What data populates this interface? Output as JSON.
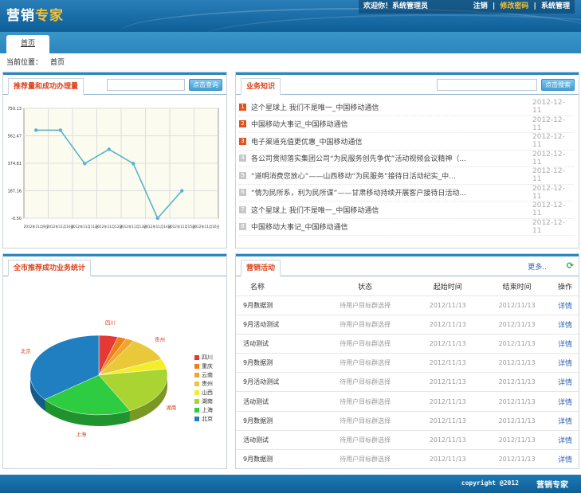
{
  "header": {
    "logo_a": "营销",
    "logo_b": "专家",
    "welcome": "欢迎你！系统管理员",
    "logout": "注销",
    "sep": "|",
    "change_password": "修改密码",
    "system_admin": "系统管理"
  },
  "nav": {
    "home_tab": "首页"
  },
  "breadcrumb": {
    "label": "当前位置：",
    "value": "首页"
  },
  "recommend": {
    "title": "推荐量和成功办理量",
    "search_button": "点击查询",
    "chart_data": {
      "type": "line",
      "categories": [
        "2012年11月9日",
        "2012年11月10日",
        "2012年11月11日",
        "2012年11月12日",
        "2012年11月13日",
        "2012年11月14日",
        "2012年11月15日",
        "2012年11月16日"
      ],
      "values": [
        601,
        601,
        373,
        470,
        373,
        -0.5,
        187
      ],
      "ytick_labels": [
        "-0.50",
        "187.16",
        "374.81",
        "562.47",
        "750.13"
      ],
      "ylim": [
        -0.5,
        750.13
      ],
      "grid": true,
      "colors": {
        "line": "#5ab2cc"
      }
    }
  },
  "knowledge": {
    "title": "业务知识",
    "search_button": "点击搜索",
    "items": [
      {
        "num": "1",
        "title": "这个星球上 我们不是唯一_中国移动通信",
        "date": "2012-12-11"
      },
      {
        "num": "2",
        "title": "中国移动大事记_中国移动通信",
        "date": "2012-12-11"
      },
      {
        "num": "3",
        "title": "电子渠道充值更优惠_中国移动通信",
        "date": "2012-12-11"
      },
      {
        "num": "4",
        "title": "各公司贯彻落实集团公司“为民服务创先争优”活动视频会议精神（...",
        "date": "2012-12-11"
      },
      {
        "num": "5",
        "title": "“道明消费您放心”——山西移动“为民服务”接待日活动纪实_中...",
        "date": "2012-12-11"
      },
      {
        "num": "6",
        "title": "“情为民所系，利为民所谋”——甘肃移动持续开展客户接待日活动...",
        "date": "2012-12-11"
      },
      {
        "num": "7",
        "title": "这个星球上 我们不是唯一_中国移动通信",
        "date": "2012-12-11"
      },
      {
        "num": "8",
        "title": "中国移动大事记_中国移动通信",
        "date": "2012-12-11"
      }
    ]
  },
  "city_stats": {
    "title": "全市推荐成功业务统计",
    "chart_data": {
      "type": "pie",
      "labels": [
        "四川",
        "重庆",
        "云南",
        "贵州",
        "山西",
        "湖南",
        "上海",
        "北京"
      ],
      "values": [
        4.5,
        2,
        2,
        10,
        4,
        20,
        22,
        35.5
      ],
      "slice_labels": [
        "四川",
        "贵州",
        "湖南",
        "上海",
        "北京"
      ],
      "colors": [
        "#e53935",
        "#f07f1b",
        "#f0a52d",
        "#e9c93a",
        "#f4ee2a",
        "#a9d431",
        "#2ecc40",
        "#1f7fc0"
      ]
    }
  },
  "activities": {
    "title": "营销活动",
    "more": "更多..",
    "refresh_icon": "refresh-icon",
    "headers": [
      "名称",
      "状态",
      "起始时间",
      "结束时间",
      "操作"
    ],
    "rows": [
      {
        "name": "9月数据测",
        "status": "待用户目标群选择",
        "start": "2012/11/13",
        "end": "2012/11/13",
        "op": "详情"
      },
      {
        "name": "9月活动测试",
        "status": "待用户目标群选择",
        "start": "2012/11/13",
        "end": "2012/11/13",
        "op": "详情"
      },
      {
        "name": "活动测试",
        "status": "待用户目标群选择",
        "start": "2012/11/13",
        "end": "2012/11/13",
        "op": "详情"
      },
      {
        "name": "9月数据测",
        "status": "待用户目标群选择",
        "start": "2012/11/13",
        "end": "2012/11/13",
        "op": "详情"
      },
      {
        "name": "9月活动测试",
        "status": "待用户目标群选择",
        "start": "2012/11/13",
        "end": "2012/11/13",
        "op": "详情"
      },
      {
        "name": "活动测试",
        "status": "待用户目标群选择",
        "start": "2012/11/13",
        "end": "2012/11/13",
        "op": "详情"
      },
      {
        "name": "9月数据测",
        "status": "待用户目标群选择",
        "start": "2012/11/13",
        "end": "2012/11/13",
        "op": "详情"
      },
      {
        "name": "活动测试",
        "status": "待用户目标群选择",
        "start": "2012/11/13",
        "end": "2012/11/13",
        "op": "详情"
      },
      {
        "name": "9月数据测",
        "status": "待用户目标群选择",
        "start": "2012/11/13",
        "end": "2012/11/13",
        "op": "详情"
      }
    ]
  },
  "footer": {
    "copyright": "copyright @2012",
    "brand": "营销专家"
  }
}
